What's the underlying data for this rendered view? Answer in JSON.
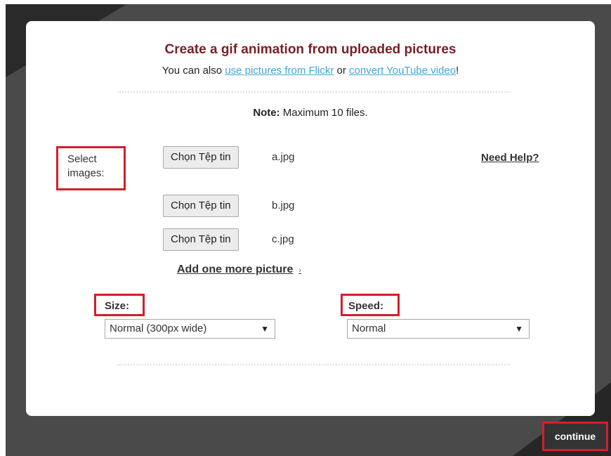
{
  "header": {
    "title": "Create a gif animation from uploaded pictures",
    "subtitle_prefix": "You can also ",
    "flickr_link": "use pictures from Flickr",
    "subtitle_middle": " or ",
    "youtube_link": "convert YouTube video",
    "subtitle_suffix": "!"
  },
  "note": {
    "label": "Note:",
    "text": " Maximum 10 files."
  },
  "files": {
    "select_label": "Select images:",
    "help_link": "Need Help?",
    "items": [
      {
        "button": "Chọn Tệp tin",
        "filename": "a.jpg"
      },
      {
        "button": "Chọn Tệp tin",
        "filename": "b.jpg"
      },
      {
        "button": "Chọn Tệp tin",
        "filename": "c.jpg"
      }
    ],
    "add_more": "Add one more picture"
  },
  "size": {
    "label": "Size:",
    "selected": "Normal (300px wide)"
  },
  "speed": {
    "label": "Speed:",
    "selected": "Normal"
  },
  "footer": {
    "continue_label": "continue"
  },
  "colors": {
    "title": "#7a1f26",
    "link": "#3fa7d9",
    "highlight": "#d0202a",
    "frame": "#4a4a4a"
  }
}
